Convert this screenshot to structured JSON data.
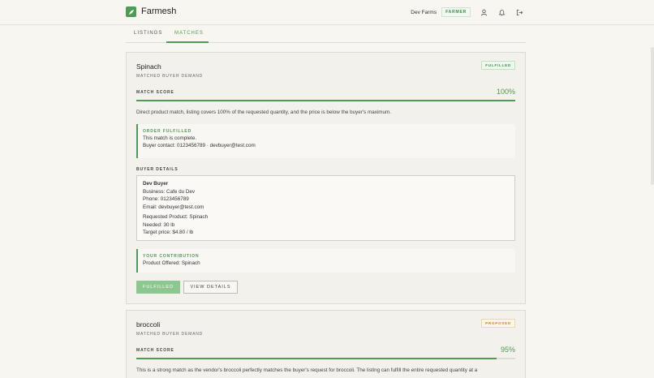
{
  "app": {
    "name": "Farmesh",
    "farm_name": "Dev Farms",
    "role": "FARMER",
    "accent": "#4f9a55",
    "icons": [
      "user-icon",
      "bell-icon",
      "logout-icon"
    ]
  },
  "tabs": [
    {
      "label": "LISTINGS"
    },
    {
      "label": "MATCHES"
    }
  ],
  "matches": [
    {
      "title": "Spinach",
      "subtitle": "MATCHED BUYER DEMAND",
      "status": "FULFILLED",
      "score_label": "MATCH SCORE",
      "score_value": "100%",
      "score_fraction": 1.0,
      "description": "Direct product match, listing covers 100% of the requested quantity, and the price is below the buyer's maximum.",
      "order": {
        "label": "ORDER FULFILLED",
        "line1": "This match is complete.",
        "line2": "Buyer contact: 0123456789 · devbuyer@test.com"
      },
      "buyer_label": "BUYER DETAILS",
      "buyer": {
        "name": "Dev Buyer",
        "business": "Business: Cafe du Dev",
        "phone": "Phone: 0123456789",
        "email": "Email: devbuyer@test.com",
        "requested": "Requested Product: Spinach",
        "needed": "Needed: 30 lb",
        "target": "Target price: $4.80 / lb"
      },
      "contribution": {
        "label": "YOUR CONTRIBUTION",
        "text": "Product Offered: Spinach"
      },
      "buttons": {
        "status": "FULFILLED",
        "view": "VIEW DETAILS"
      }
    },
    {
      "title": "broccoli",
      "subtitle": "MATCHED BUYER DEMAND",
      "status": "PROPOSED",
      "score_label": "MATCH SCORE",
      "score_value": "95%",
      "score_fraction": 0.95,
      "description": "This is a strong match as the vendor's broccoli perfectly matches the buyer's request for broccoli. The listing can fulfill the entire requested quantity at a"
    }
  ]
}
